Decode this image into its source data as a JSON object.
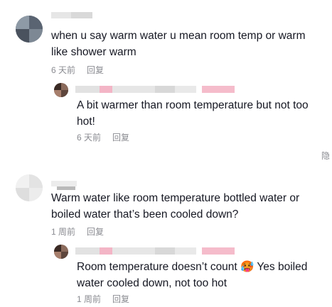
{
  "comments": [
    {
      "text": "when u say warm water u mean room temp or warm like shower warm",
      "time": "6 天前",
      "reply_label": "回复",
      "reply": {
        "text": "A bit warmer than room temperature but not too hot!",
        "time": "6 天前",
        "reply_label": "回复"
      }
    },
    {
      "text": "Warm water like room temperature bottled water or boiled water that’s been cooled down?",
      "time": "1 周前",
      "reply_label": "回复",
      "reply": {
        "text": "Room temperature doesn’t count 🥵 Yes boiled water cooled down, not too hot",
        "time": "1 周前",
        "reply_label": "回复"
      }
    }
  ],
  "hide_label": "隐"
}
